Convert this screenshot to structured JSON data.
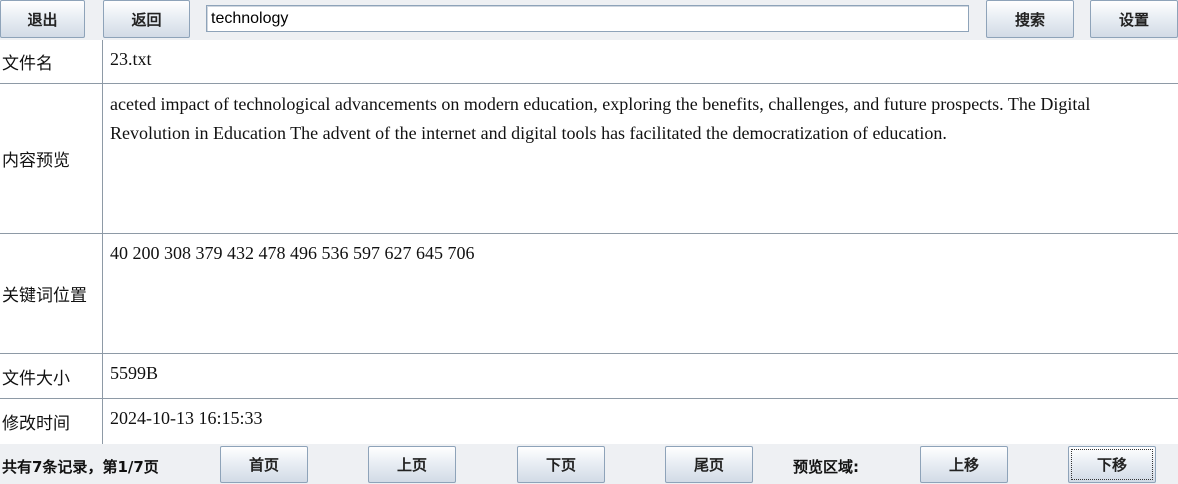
{
  "toolbar": {
    "exit_label": "退出",
    "back_label": "返回",
    "search_value": "technology",
    "search_label": "搜索",
    "settings_label": "设置"
  },
  "details": {
    "file_name": {
      "label": "文件名",
      "value": "23.txt"
    },
    "preview": {
      "label": "内容预览",
      "value": "aceted impact of technological advancements on modern education, exploring the benefits, challenges, and future prospects. The Digital Revolution in Education The advent of the internet and digital tools has facilitated the democratization of education."
    },
    "keyword_positions": {
      "label": "关键词位置",
      "value": "40 200 308 379 432 478 496 536 597 627 645 706"
    },
    "file_size": {
      "label": "文件大小",
      "value": "5599B"
    },
    "modified_time": {
      "label": "修改时间",
      "value": "2024-10-13 16:15:33"
    }
  },
  "pagination": {
    "info": "共有7条记录，第1/7页",
    "first_label": "首页",
    "prev_label": "上页",
    "next_label": "下页",
    "last_label": "尾页",
    "preview_area_label": "预览区域:",
    "move_up_label": "上移",
    "move_down_label": "下移"
  }
}
